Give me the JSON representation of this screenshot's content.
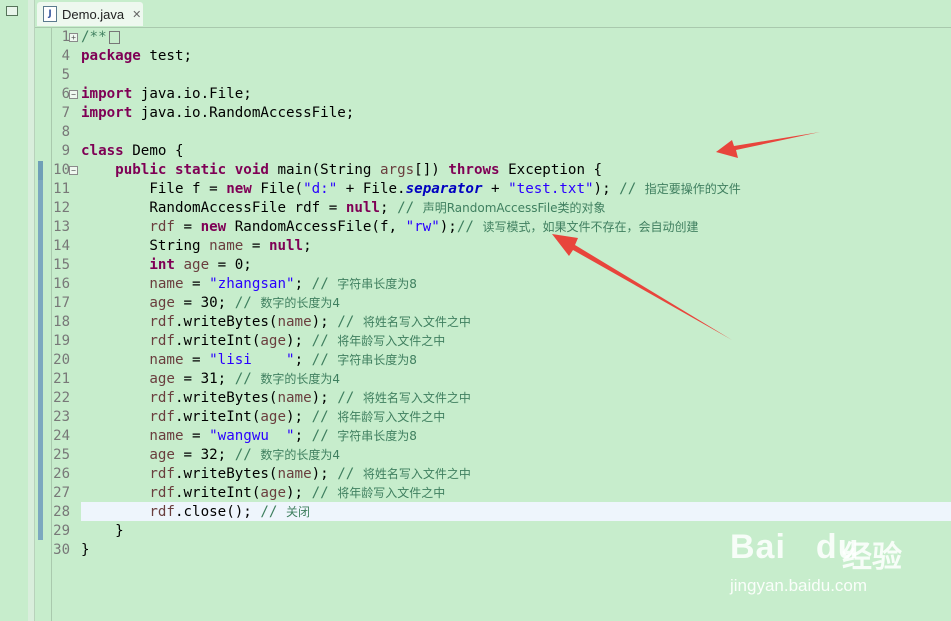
{
  "tab": {
    "title": "Demo.java",
    "icon": "J",
    "close_glyph": "✕"
  },
  "line_numbers": [
    "1",
    "4",
    "5",
    "6",
    "7",
    "8",
    "9",
    "10",
    "11",
    "12",
    "13",
    "14",
    "15",
    "16",
    "17",
    "18",
    "19",
    "20",
    "21",
    "22",
    "23",
    "24",
    "25",
    "26",
    "27",
    "28",
    "29",
    "30"
  ],
  "code": {
    "l1": "/**",
    "l4_kw": "package",
    "l4_rest": " test;",
    "l6_kw": "import",
    "l6_rest": " java.io.File;",
    "l7_kw": "import",
    "l7_rest": " java.io.RandomAccessFile;",
    "l9_kw": "class",
    "l9_rest": " Demo {",
    "l10_kw1": "public",
    "l10_kw2": "static",
    "l10_kw3": "void",
    "l10_a": " main(String ",
    "l10_var": "args",
    "l10_b": "[]) ",
    "l10_kw4": "throws",
    "l10_c": " Exception {",
    "l11_a": "File f = ",
    "l11_kw": "new",
    "l11_b": " File(",
    "l11_s1": "\"d:\"",
    "l11_c": " + File.",
    "l11_fld": "separator",
    "l11_d": " + ",
    "l11_s2": "\"test.txt\"",
    "l11_e": "); ",
    "l11_cm": "// ",
    "l11_cn": "指定要操作的文件",
    "l12_a": "RandomAccessFile rdf = ",
    "l12_kw": "null",
    "l12_b": "; ",
    "l12_cm": "// ",
    "l12_cn": "声明RandomAccessFile类的对象",
    "l13_var": "rdf",
    "l13_a": " = ",
    "l13_kw": "new",
    "l13_b": " RandomAccessFile(f, ",
    "l13_s": "\"rw\"",
    "l13_c": ");",
    "l13_cm": "// ",
    "l13_cn": "读写模式，如果文件不存在，会自动创建",
    "l14_a": "String ",
    "l14_var": "name",
    "l14_b": " = ",
    "l14_kw": "null",
    "l14_c": ";",
    "l15_kw": "int",
    "l15_a": " ",
    "l15_var": "age",
    "l15_b": " = 0;",
    "l16_var": "name",
    "l16_a": " = ",
    "l16_s": "\"zhangsan\"",
    "l16_b": "; ",
    "l16_cm": "// ",
    "l16_cn": "字符串长度为8",
    "l17_var": "age",
    "l17_a": " = 30; ",
    "l17_cm": "// ",
    "l17_cn": "数字的长度为4",
    "l18_var": "rdf",
    "l18_a": ".writeBytes(",
    "l18_var2": "name",
    "l18_b": "); ",
    "l18_cm": "// ",
    "l18_cn": "将姓名写入文件之中",
    "l19_var": "rdf",
    "l19_a": ".writeInt(",
    "l19_var2": "age",
    "l19_b": "); ",
    "l19_cm": "// ",
    "l19_cn": "将年龄写入文件之中",
    "l20_var": "name",
    "l20_a": " = ",
    "l20_s": "\"lisi    \"",
    "l20_b": "; ",
    "l20_cm": "// ",
    "l20_cn": "字符串长度为8",
    "l21_var": "age",
    "l21_a": " = 31; ",
    "l21_cm": "// ",
    "l21_cn": "数字的长度为4",
    "l22_var": "rdf",
    "l22_a": ".writeBytes(",
    "l22_var2": "name",
    "l22_b": "); ",
    "l22_cm": "// ",
    "l22_cn": "将姓名写入文件之中",
    "l23_var": "rdf",
    "l23_a": ".writeInt(",
    "l23_var2": "age",
    "l23_b": "); ",
    "l23_cm": "// ",
    "l23_cn": "将年龄写入文件之中",
    "l24_var": "name",
    "l24_a": " = ",
    "l24_s": "\"wangwu  \"",
    "l24_b": "; ",
    "l24_cm": "// ",
    "l24_cn": "字符串长度为8",
    "l25_var": "age",
    "l25_a": " = 32; ",
    "l25_cm": "// ",
    "l25_cn": "数字的长度为4",
    "l26_var": "rdf",
    "l26_a": ".writeBytes(",
    "l26_var2": "name",
    "l26_b": "); ",
    "l26_cm": "// ",
    "l26_cn": "将姓名写入文件之中",
    "l27_var": "rdf",
    "l27_a": ".writeInt(",
    "l27_var2": "age",
    "l27_b": "); ",
    "l27_cm": "// ",
    "l27_cn": "将年龄写入文件之中",
    "l28_var": "rdf",
    "l28_a": ".close(); ",
    "l28_cm": "// ",
    "l28_cn": "关闭",
    "l29": "}",
    "l30": "}"
  },
  "watermark": {
    "brand": "Bai",
    "brand2": "du",
    "cn": "经验",
    "url": "jingyan.baidu.com"
  },
  "colors": {
    "background": "#c7edcc",
    "keyword": "#7f0055",
    "string": "#2a00ff",
    "comment": "#3f7f5f",
    "arrow": "#e8453c"
  }
}
